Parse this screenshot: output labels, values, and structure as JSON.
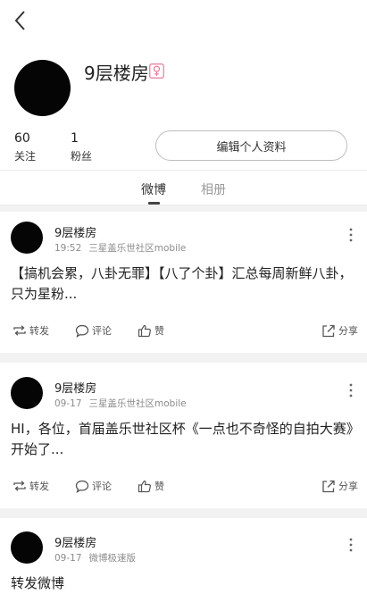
{
  "profile": {
    "name": "9层楼房",
    "following_count": "60",
    "following_label": "关注",
    "followers_count": "1",
    "followers_label": "粉丝",
    "edit_profile_label": "编辑个人资料"
  },
  "tabs": [
    {
      "label": "微博",
      "active": true
    },
    {
      "label": "相册",
      "active": false
    }
  ],
  "actions": {
    "repost": "转发",
    "comment": "评论",
    "like": "赞",
    "share": "分享"
  },
  "posts": [
    {
      "author": "9层楼房",
      "time": "19:52",
      "source": "三星盖乐世社区mobile",
      "text": "【搞机会累，八卦无罪】【八了个卦】汇总每周新鲜八卦，只为星粉..."
    },
    {
      "author": "9层楼房",
      "time": "09-17",
      "source": "三星盖乐世社区mobile",
      "text": "HI，各位，首届盖乐世社区杯《一点也不奇怪的自拍大赛》开始了..."
    },
    {
      "author": "9层楼房",
      "time": "09-17",
      "source": "微博极速版",
      "text": "转发微博"
    }
  ],
  "colors": {
    "gender_icon": "#e87a9a",
    "background_gap": "#f2f2f2",
    "tab_underline": "#444444"
  },
  "icons": {
    "back": "chevron-left-icon",
    "gender": "female-icon",
    "more": "vertical-ellipsis-icon",
    "repost": "repost-icon",
    "comment": "comment-icon",
    "like": "thumbs-up-icon",
    "share": "share-icon"
  }
}
